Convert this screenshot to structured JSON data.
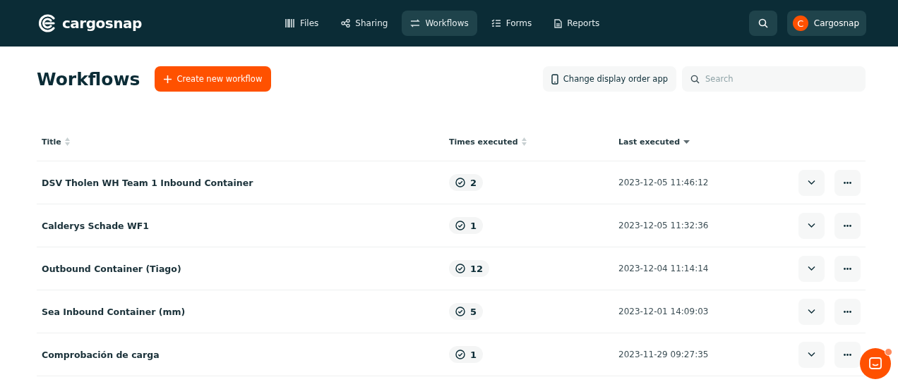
{
  "brand": {
    "name": "cargosnap"
  },
  "nav": [
    {
      "label": "Files",
      "selected": false
    },
    {
      "label": "Sharing",
      "selected": false
    },
    {
      "label": "Workflows",
      "selected": true
    },
    {
      "label": "Forms",
      "selected": false
    },
    {
      "label": "Reports",
      "selected": false
    }
  ],
  "account": {
    "initial": "C",
    "name": "Cargosnap"
  },
  "page": {
    "title": "Workflows",
    "create_button": "Create new workflow",
    "order_button": "Change display order app",
    "search": {
      "placeholder": "Search"
    }
  },
  "table": {
    "columns": [
      {
        "label": "Title",
        "sorted": false
      },
      {
        "label": "Times executed",
        "sorted": false
      },
      {
        "label": "Last executed",
        "sorted": true
      }
    ],
    "rows": [
      {
        "title": "DSV Tholen WH Team 1 Inbound Container",
        "times": "2",
        "last": "2023-12-05 11:46:12"
      },
      {
        "title": "Calderys Schade WF1",
        "times": "1",
        "last": "2023-12-05 11:32:36"
      },
      {
        "title": "Outbound Container (Tiago)",
        "times": "12",
        "last": "2023-12-04 11:14:14"
      },
      {
        "title": "Sea Inbound Container (mm)",
        "times": "5",
        "last": "2023-12-01 14:09:03"
      },
      {
        "title": "Comprobación de carga",
        "times": "1",
        "last": "2023-11-29 09:27:35"
      }
    ]
  },
  "chat": {
    "unread": true
  }
}
